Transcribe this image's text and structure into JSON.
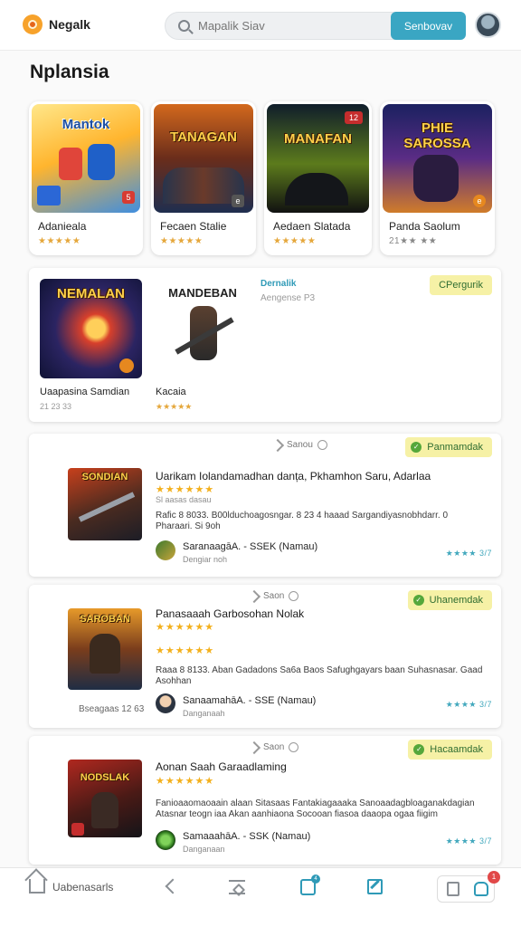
{
  "header": {
    "brand": "Negalk",
    "search_placeholder": "Mapalik Siav",
    "search_button": "Senbovav"
  },
  "page": {
    "title": "Nplansia"
  },
  "featured": [
    {
      "art": "Mantok",
      "name": "Adanieala",
      "sub": "★★★★★",
      "badge": "5"
    },
    {
      "art": "TANAGAN",
      "name": "Fecaen Stalie",
      "sub": "★★★★★",
      "badge": "e"
    },
    {
      "art": "MANAFAN",
      "name": "Aedaen Slatada",
      "sub": "★★★★★",
      "badge": "12"
    },
    {
      "art": "PHIE SAROSSA",
      "name": "Panda Saolum",
      "sub": "21★★ ★★",
      "badge": "e"
    }
  ],
  "spotlight": {
    "tag": "Dernalik",
    "subtitle": "Aengense P3",
    "pill": "CPergurik",
    "items": [
      {
        "art": "NEMALAN",
        "name": "Uaapasina Samdian",
        "meta": "21 23 33"
      },
      {
        "art": "MANDEBAN",
        "name": "Kacaia",
        "meta": "★★★★★"
      }
    ]
  },
  "list": [
    {
      "meta": "Sanou",
      "pill": "Panmamdak",
      "art": "SONDIAN",
      "title": "Uarikam Iolandamadhan danța, Pkhamhon Saru, Adarlaa",
      "stars": "★★★★★★",
      "sub": "Sl aasas dasau",
      "desc": "Rafic 8 8033. B00lduchoagosngar. 8 23 4 haaad Sargandiyasnobhdarr. 0 Pharaari. Si 9oh",
      "author": "SaranaagāA. - SSEK (Namau)",
      "author_sub": "Dengiar noh",
      "rating": "★★★★ 3/7",
      "extra": ""
    },
    {
      "meta": "Saon",
      "pill": "Uhanemdak",
      "art": "SAROBAN",
      "title": "Panasaaah Garbosohan Nolak",
      "stars": "★★★★★★",
      "sub": "★★★★★★",
      "desc": "Raaa 8 8133. Aban Gadadons Sa6a Baos Safughgayars baan Suhasnasar. Gaad Asohhan",
      "author": "SanaamahāA. - SSE (Namau)",
      "author_sub": "Danganaah",
      "rating": "★★★★ 3/7",
      "extra": "Bseagaas 12 63"
    },
    {
      "meta": "Saon",
      "pill": "Hacaamdak",
      "art": "NODSLAK",
      "title": "Aonan Saah Garaadlaming",
      "stars": "★★★★★★",
      "sub": "",
      "desc": "Fanioaaomaoaain alaan Sitasaas Fantakiagaaaka Sanoaadagbloaganakdagian Atasnar teogn iaa Akan aanhiaona Socooan fiasoa daaopa ogaa fiigim",
      "author": "SamaaahāA. - SSK (Namau)",
      "author_sub": "Danganaan",
      "rating": "★★★★ 3/7",
      "extra": ""
    }
  ],
  "nav": {
    "home_label": "Uabenasarls",
    "badge_count": "1",
    "bookmark_count": "4"
  }
}
